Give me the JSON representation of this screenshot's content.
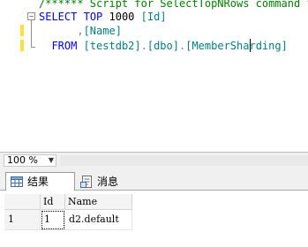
{
  "editor": {
    "lines": [
      {
        "segments": [
          {
            "text": "/****** Script for SelectTopNRows command fr",
            "cls": "c-comment"
          }
        ]
      },
      {
        "segments": [
          {
            "text": "SELECT",
            "cls": "c-kw"
          },
          {
            "text": " ",
            "cls": "c-plain"
          },
          {
            "text": "TOP",
            "cls": "c-kw"
          },
          {
            "text": " 1000 ",
            "cls": "c-plain"
          },
          {
            "text": "[Id]",
            "cls": "c-ident"
          }
        ]
      },
      {
        "segments": [
          {
            "text": "      ,",
            "cls": "c-gray"
          },
          {
            "text": "[Name]",
            "cls": "c-ident"
          }
        ]
      },
      {
        "segments": [
          {
            "text": "  ",
            "cls": "c-plain"
          },
          {
            "text": "FROM",
            "cls": "c-kw"
          },
          {
            "text": " ",
            "cls": "c-plain"
          },
          {
            "text": "[testdb2]",
            "cls": "c-ident"
          },
          {
            "text": ".",
            "cls": "c-gray"
          },
          {
            "text": "[dbo]",
            "cls": "c-ident"
          },
          {
            "text": ".",
            "cls": "c-gray"
          },
          {
            "text": "[MemberSharding]",
            "cls": "c-ident"
          }
        ]
      }
    ],
    "collapse_glyph": "−",
    "colors": {
      "keyword": "#0000ff",
      "comment": "#008000",
      "identifier": "#008080",
      "change_marker": "#ffe13a"
    }
  },
  "zoom": {
    "value": "100 %"
  },
  "tabs": [
    {
      "label": "结果",
      "icon": "grid-icon",
      "active": true
    },
    {
      "label": "消息",
      "icon": "message-icon",
      "active": false
    }
  ],
  "grid": {
    "columns": [
      "Id",
      "Name"
    ],
    "rows": [
      {
        "rownum": "1",
        "cells": [
          "1",
          "d2.default"
        ]
      }
    ]
  }
}
